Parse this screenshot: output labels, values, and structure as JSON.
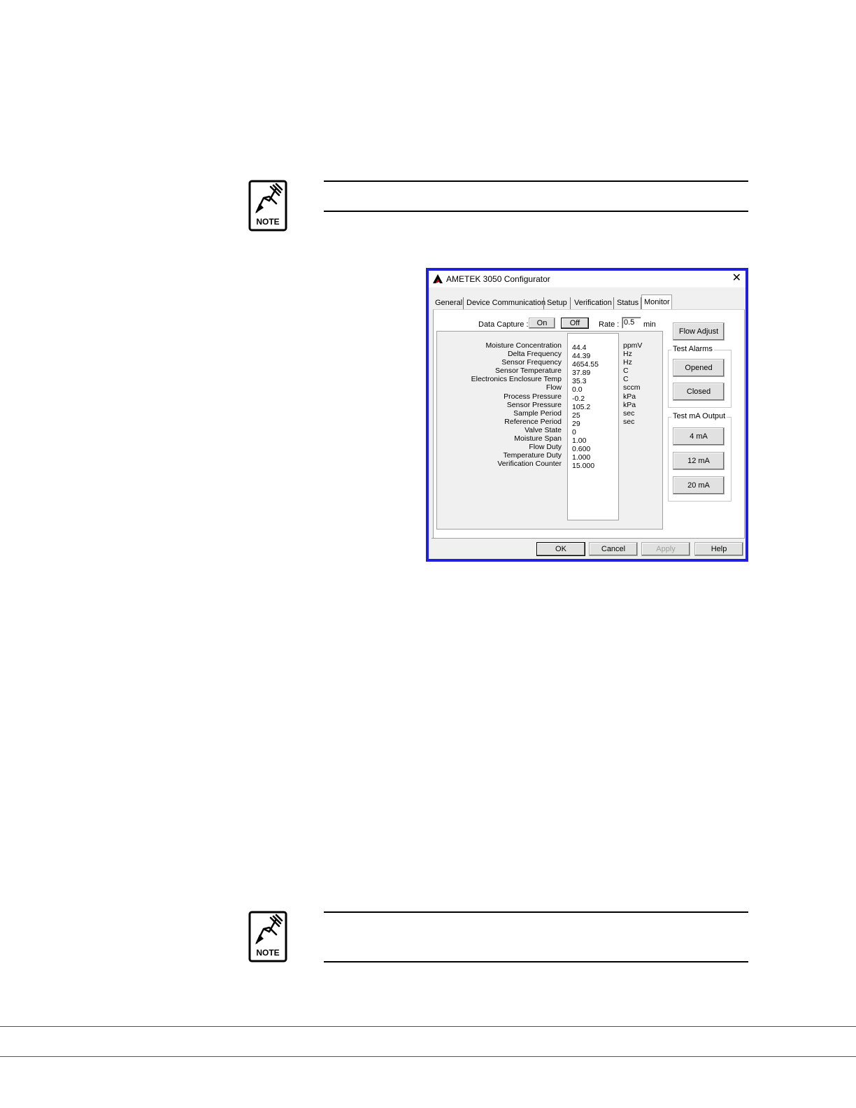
{
  "colors": {
    "dialog_border": "#1f1fe0",
    "logo_red": "#d00000"
  },
  "note_icons": [
    {
      "label": "NOTE",
      "icon": "note-hand-pencil-icon"
    },
    {
      "label": "NOTE",
      "icon": "note-hand-pencil-icon"
    }
  ],
  "dialog": {
    "title": "AMETEK 3050 Configurator",
    "close_icon": "close-icon",
    "tabs": [
      {
        "label": "General"
      },
      {
        "label": "Device Communication"
      },
      {
        "label": "Setup"
      },
      {
        "label": "Verification"
      },
      {
        "label": "Status"
      },
      {
        "label": "Monitor",
        "active": true
      }
    ],
    "data_capture": {
      "label": "Data Capture :",
      "on": "On",
      "off": "Off"
    },
    "rate": {
      "label": "Rate :",
      "value": "0.5",
      "unit": "min"
    },
    "parameters": [
      {
        "name": "Moisture Concentration",
        "value": "44.4",
        "unit": "ppmV"
      },
      {
        "name": "Delta Frequency",
        "value": "44.39",
        "unit": "Hz"
      },
      {
        "name": "Sensor Frequency",
        "value": "4654.55",
        "unit": "Hz"
      },
      {
        "name": "Sensor Temperature",
        "value": "37.89",
        "unit": "C"
      },
      {
        "name": "Electronics Enclosure Temp",
        "value": "35.3",
        "unit": "C"
      },
      {
        "name": "Flow",
        "value": "0.0",
        "unit": "sccm"
      },
      {
        "name": "Process Pressure",
        "value": "-0.2",
        "unit": "kPa"
      },
      {
        "name": "Sensor Pressure",
        "value": "105.2",
        "unit": "kPa"
      },
      {
        "name": "Sample Period",
        "value": "25",
        "unit": "sec"
      },
      {
        "name": "Reference Period",
        "value": "29",
        "unit": "sec"
      },
      {
        "name": "Valve State",
        "value": "0",
        "unit": ""
      },
      {
        "name": "Moisture Span",
        "value": "1.00",
        "unit": ""
      },
      {
        "name": "Flow Duty",
        "value": "0.600",
        "unit": ""
      },
      {
        "name": "Temperature Duty",
        "value": "1.000",
        "unit": ""
      },
      {
        "name": "Verification Counter",
        "value": "15.000",
        "unit": ""
      }
    ],
    "flow_adjust": "Flow Adjust",
    "test_alarms": {
      "legend": "Test Alarms",
      "opened": "Opened",
      "closed": "Closed"
    },
    "test_ma_output": {
      "legend": "Test mA Output",
      "ma4": "4 mA",
      "ma12": "12 mA",
      "ma20": "20 mA"
    },
    "footer": {
      "ok": "OK",
      "cancel": "Cancel",
      "apply": "Apply",
      "help": "Help"
    }
  }
}
